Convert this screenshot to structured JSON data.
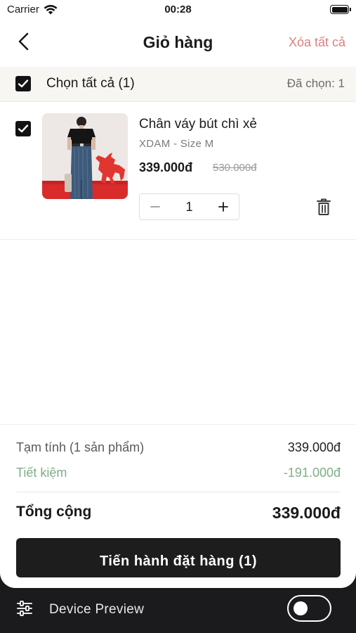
{
  "status_bar": {
    "carrier": "Carrier",
    "time": "00:28"
  },
  "nav": {
    "title": "Giỏ hàng",
    "clear_all": "Xóa tất cả"
  },
  "select_bar": {
    "label": "Chọn tất cả (1)",
    "selected_count": "Đã chọn: 1",
    "checked": true
  },
  "cart_items": [
    {
      "checked": true,
      "name": "Chân váy bút chì xẻ",
      "variant": "XDAM - Size M",
      "price": "339.000đ",
      "old_price": "530.000đ",
      "quantity": "1"
    }
  ],
  "summary": {
    "subtotal_label": "Tạm tính (1 sản phẩm)",
    "subtotal_value": "339.000đ",
    "savings_label": "Tiết kiệm",
    "savings_value": "-191.000đ",
    "total_label": "Tổng cộng",
    "total_value": "339.000đ",
    "checkout_label": "Tiến hành đặt hàng (1)"
  },
  "device_preview": {
    "label": "Device Preview",
    "enabled": false
  },
  "colors": {
    "accent_clear": "#d9807f",
    "savings": "#7fae86",
    "button_bg": "#1d1d1d"
  }
}
